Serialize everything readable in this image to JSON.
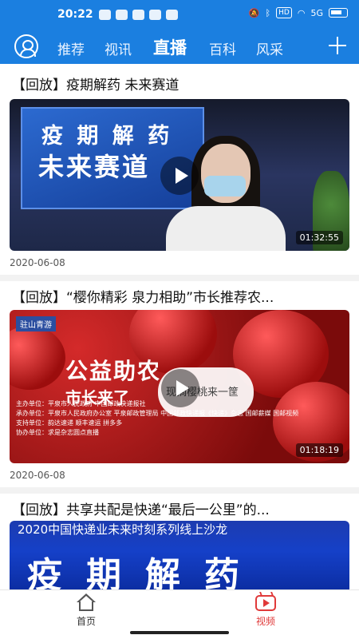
{
  "status_bar": {
    "time": "20:22",
    "network": "5G",
    "hd_label": "HD",
    "colors": {
      "background": "#1b7fe0"
    }
  },
  "header": {
    "tabs": [
      {
        "label": "推荐",
        "active": false
      },
      {
        "label": "视讯",
        "active": false
      },
      {
        "label": "直播",
        "active": true
      },
      {
        "label": "百科",
        "active": false
      },
      {
        "label": "风采",
        "active": false
      }
    ],
    "left_icon": "avatar-icon",
    "right_icon": "plus-icon"
  },
  "feed": {
    "items": [
      {
        "title": "【回放】疫期解药 未来赛道",
        "thumbnail_text": [
          "疫 期 解 药",
          "未来赛道"
        ],
        "duration": "01:32:55",
        "date": "2020-06-08"
      },
      {
        "title": "【回放】“樱你精彩 泉力相助”市长推荐农...",
        "thumbnail_text": [
          "驻山青游",
          "公益助农",
          "市长来了",
          "现摘樱桃来一筐"
        ],
        "thumbnail_info": [
          "主办单位：平泉市人民政府  中国邮政快递报社",
          "承办单位：平泉市人民政府办公室  平泉邮政管理局  中国邮政快递报《快递》杂志  国邮薪媒  国邮视频",
          "支持单位：韵达速递  顺丰速运  拼多多",
          "协办单位：求是杂志圆点直播"
        ],
        "duration": "01:18:19",
        "date": "2020-06-08"
      },
      {
        "title": "【回放】共享共配是快递“最后一公里”的...",
        "thumbnail_text": [
          "2020中国快递业未来时刻系列线上沙龙",
          "疫期解药"
        ]
      }
    ]
  },
  "bottom_nav": {
    "items": [
      {
        "label": "首页",
        "icon": "home-icon",
        "active": false
      },
      {
        "label": "视频",
        "icon": "video-icon",
        "active": true
      }
    ],
    "colors": {
      "active": "#e03a3a",
      "inactive": "#333333"
    }
  }
}
